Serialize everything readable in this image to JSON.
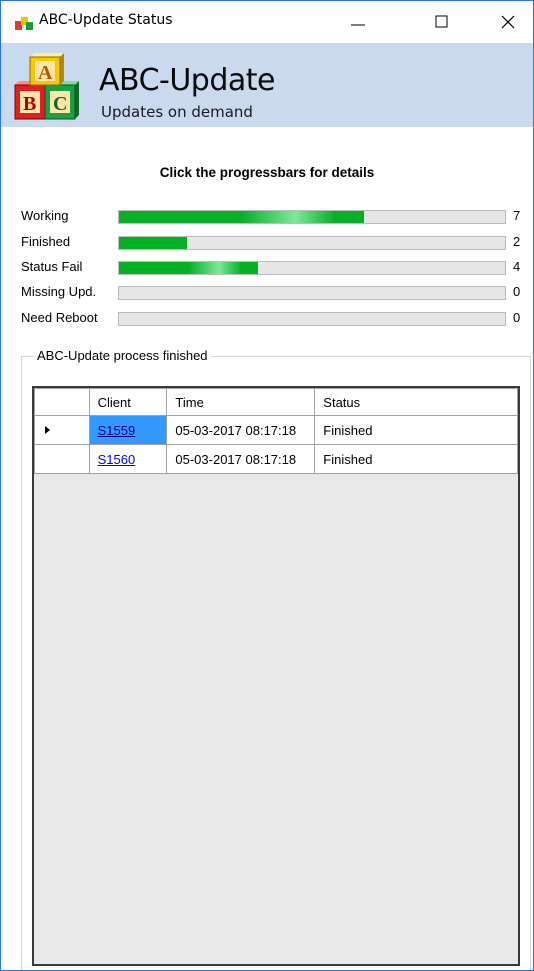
{
  "window": {
    "title": "ABC-Update  Status",
    "minimize_glyph": "minimize-icon",
    "maximize_glyph": "maximize-icon",
    "close_glyph": "close-icon"
  },
  "banner": {
    "title": "ABC-Update",
    "subtitle": "Updates on demand",
    "background": "#c9daee"
  },
  "hint": "Click the progressbars for details",
  "progress": {
    "accent": "#06b025",
    "rows": [
      {
        "label": "Working",
        "count": "7",
        "fill_fraction": 0.635
      },
      {
        "label": "Finished",
        "count": "2",
        "fill_fraction": 0.175
      },
      {
        "label": "Status Fail",
        "count": "4",
        "fill_fraction": 0.36
      },
      {
        "label": "Missing Upd.",
        "count": "0",
        "fill_fraction": 0
      },
      {
        "label": "Need Reboot",
        "count": "0",
        "fill_fraction": 0
      }
    ]
  },
  "group": {
    "title": "ABC-Update process finished"
  },
  "table": {
    "columns": [
      "Client",
      "Time",
      "Status"
    ],
    "rows": [
      {
        "client": "S1559",
        "time": "05-03-2017 08:17:18",
        "status": "Finished"
      },
      {
        "client": "S1560",
        "time": "05-03-2017 08:17:18",
        "status": "Finished"
      }
    ]
  }
}
